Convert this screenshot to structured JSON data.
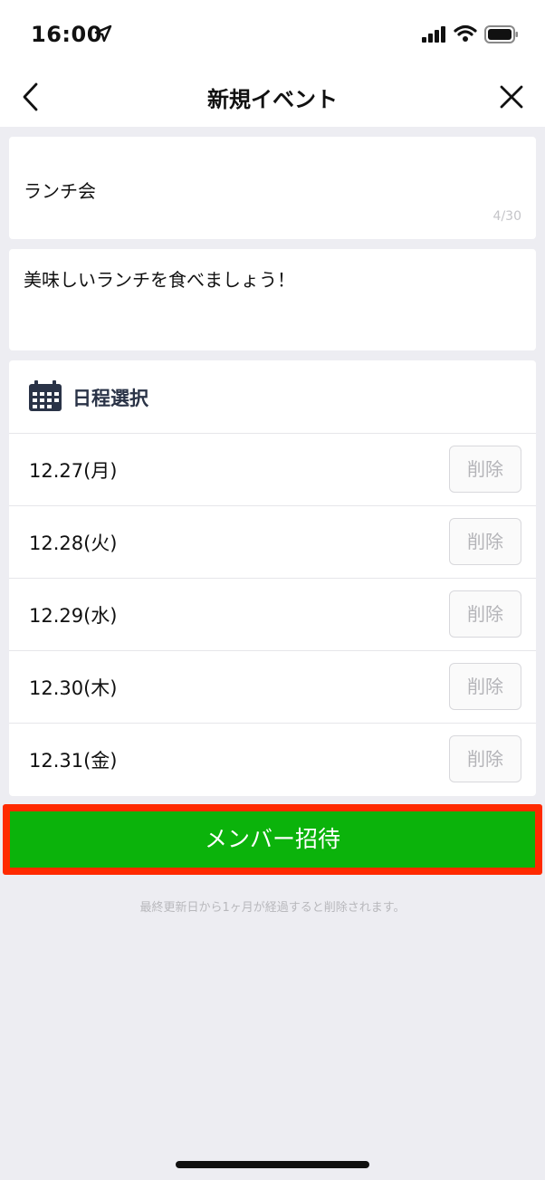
{
  "status_bar": {
    "time": "16:00"
  },
  "nav": {
    "title": "新規イベント"
  },
  "event": {
    "title": "ランチ会",
    "title_count": "4/30",
    "description": "美味しいランチを食べましょう！"
  },
  "schedule": {
    "heading": "日程選択",
    "dates": [
      {
        "label": "12.27(月)",
        "delete": "削除"
      },
      {
        "label": "12.28(火)",
        "delete": "削除"
      },
      {
        "label": "12.29(水)",
        "delete": "削除"
      },
      {
        "label": "12.30(木)",
        "delete": "削除"
      },
      {
        "label": "12.31(金)",
        "delete": "削除"
      }
    ]
  },
  "invite_button": "メンバー招待",
  "footer_note": "最終更新日から1ヶ月が経過すると削除されます。",
  "colors": {
    "accent_green": "#0bb30b",
    "highlight_red": "#ff2a00",
    "schedule_icon": "#2a3347"
  }
}
